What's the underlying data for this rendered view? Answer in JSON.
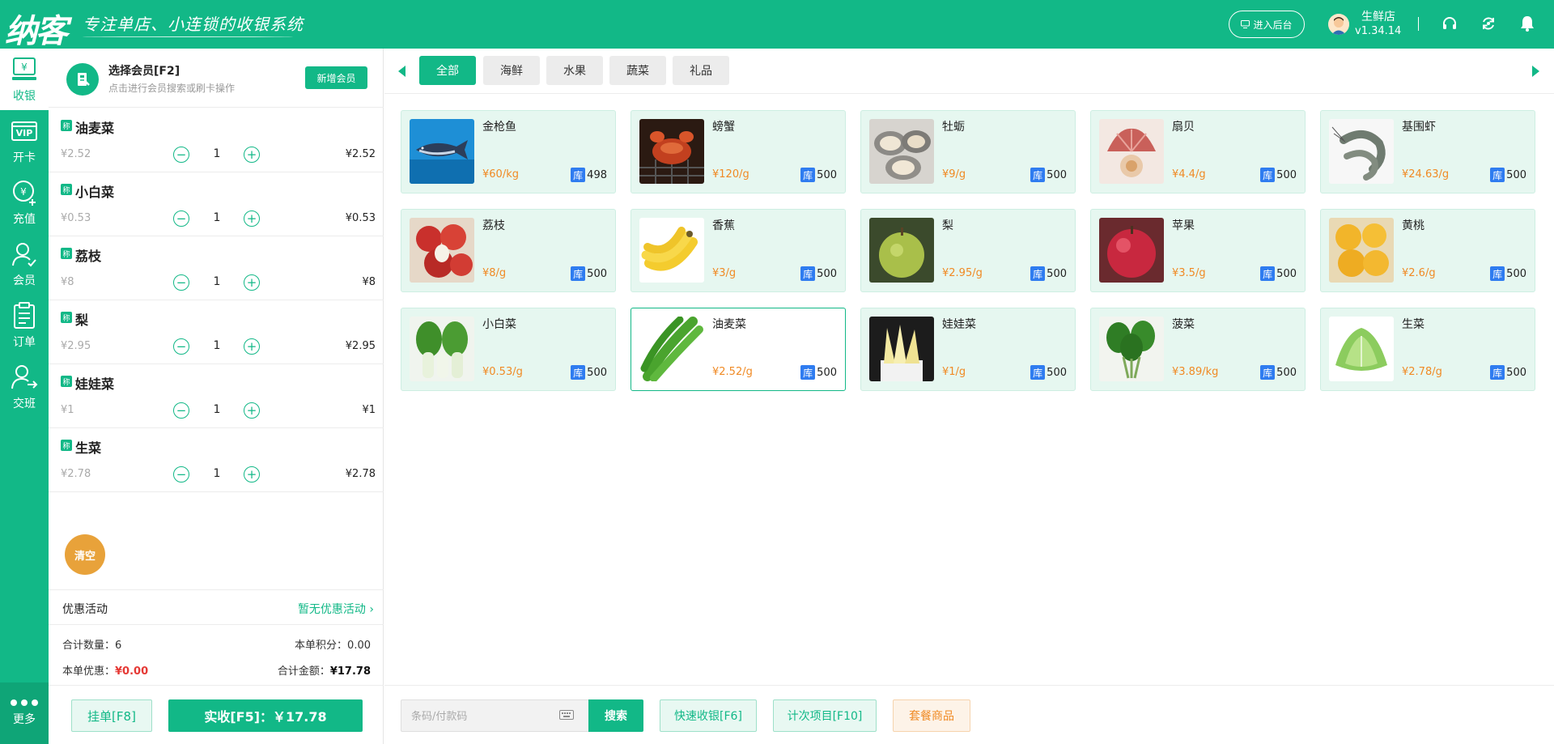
{
  "header": {
    "logo_text": "纳客",
    "slogan": "专注单店、小连锁的收银系统",
    "backend_label": "进入后台",
    "store_name": "生鲜店",
    "version": "v1.34.14"
  },
  "sidenav": {
    "items": [
      {
        "label": "收银",
        "icon": "register-icon"
      },
      {
        "label": "开卡",
        "icon": "vip-card-icon"
      },
      {
        "label": "充值",
        "icon": "recharge-icon"
      },
      {
        "label": "会员",
        "icon": "member-icon"
      },
      {
        "label": "订单",
        "icon": "order-icon"
      },
      {
        "label": "交班",
        "icon": "handover-icon"
      }
    ],
    "more_label": "更多"
  },
  "member": {
    "title": "选择会员[F2]",
    "hint": "点击进行会员搜索或刷卡操作",
    "new_button": "新增会员"
  },
  "cart": {
    "tag": "称",
    "items": [
      {
        "name": "油麦菜",
        "unit_price": "¥2.52",
        "qty": "1",
        "total": "¥2.52"
      },
      {
        "name": "小白菜",
        "unit_price": "¥0.53",
        "qty": "1",
        "total": "¥0.53"
      },
      {
        "name": "荔枝",
        "unit_price": "¥8",
        "qty": "1",
        "total": "¥8"
      },
      {
        "name": "梨",
        "unit_price": "¥2.95",
        "qty": "1",
        "total": "¥2.95"
      },
      {
        "name": "娃娃菜",
        "unit_price": "¥1",
        "qty": "1",
        "total": "¥1"
      },
      {
        "name": "生菜",
        "unit_price": "¥2.78",
        "qty": "1",
        "total": "¥2.78"
      }
    ],
    "clear_label": "清空",
    "promo_label": "优惠活动",
    "promo_value": "暂无优惠活动",
    "total_qty_label": "合计数量：",
    "total_qty": "6",
    "points_label": "本单积分：",
    "points": "0.00",
    "discount_label": "本单优惠：",
    "discount": "¥0.00",
    "amount_label": "合计金额：",
    "amount": "¥17.78",
    "hold_button": "挂单[F8]",
    "pay_button": "实收[F5]：￥17.78"
  },
  "categories": [
    "全部",
    "海鲜",
    "水果",
    "蔬菜",
    "礼品"
  ],
  "stock_tag": "库",
  "products": [
    {
      "name": "金枪鱼",
      "price": "¥60/kg",
      "stock": "498",
      "image": "tuna-image"
    },
    {
      "name": "螃蟹",
      "price": "¥120/g",
      "stock": "500",
      "image": "crab-image"
    },
    {
      "name": "牡蛎",
      "price": "¥9/g",
      "stock": "500",
      "image": "oyster-image"
    },
    {
      "name": "扇贝",
      "price": "¥4.4/g",
      "stock": "500",
      "image": "scallop-image"
    },
    {
      "name": "基围虾",
      "price": "¥24.63/g",
      "stock": "500",
      "image": "shrimp-image"
    },
    {
      "name": "荔枝",
      "price": "¥8/g",
      "stock": "500",
      "image": "lychee-image"
    },
    {
      "name": "香蕉",
      "price": "¥3/g",
      "stock": "500",
      "image": "banana-image"
    },
    {
      "name": "梨",
      "price": "¥2.95/g",
      "stock": "500",
      "image": "pear-image"
    },
    {
      "name": "苹果",
      "price": "¥3.5/g",
      "stock": "500",
      "image": "apple-image"
    },
    {
      "name": "黄桃",
      "price": "¥2.6/g",
      "stock": "500",
      "image": "peach-image"
    },
    {
      "name": "小白菜",
      "price": "¥0.53/g",
      "stock": "500",
      "image": "bokchoy-image"
    },
    {
      "name": "油麦菜",
      "price": "¥2.52/g",
      "stock": "500",
      "image": "lettuce-leaf-image"
    },
    {
      "name": "娃娃菜",
      "price": "¥1/g",
      "stock": "500",
      "image": "baby-cabbage-image"
    },
    {
      "name": "菠菜",
      "price": "¥3.89/kg",
      "stock": "500",
      "image": "spinach-image"
    },
    {
      "name": "生菜",
      "price": "¥2.78/g",
      "stock": "500",
      "image": "lettuce-image"
    }
  ],
  "bottom": {
    "search_placeholder": "条码/付款码",
    "search_button": "搜索",
    "quick_pay": "快速收银[F6]",
    "count_items": "计次项目[F10]",
    "combo": "套餐商品"
  },
  "colors": {
    "brand": "#12b887",
    "price": "#f08a24",
    "stock_tag": "#2f7cf0",
    "discount": "#e53935",
    "clear": "#e8a23a"
  }
}
